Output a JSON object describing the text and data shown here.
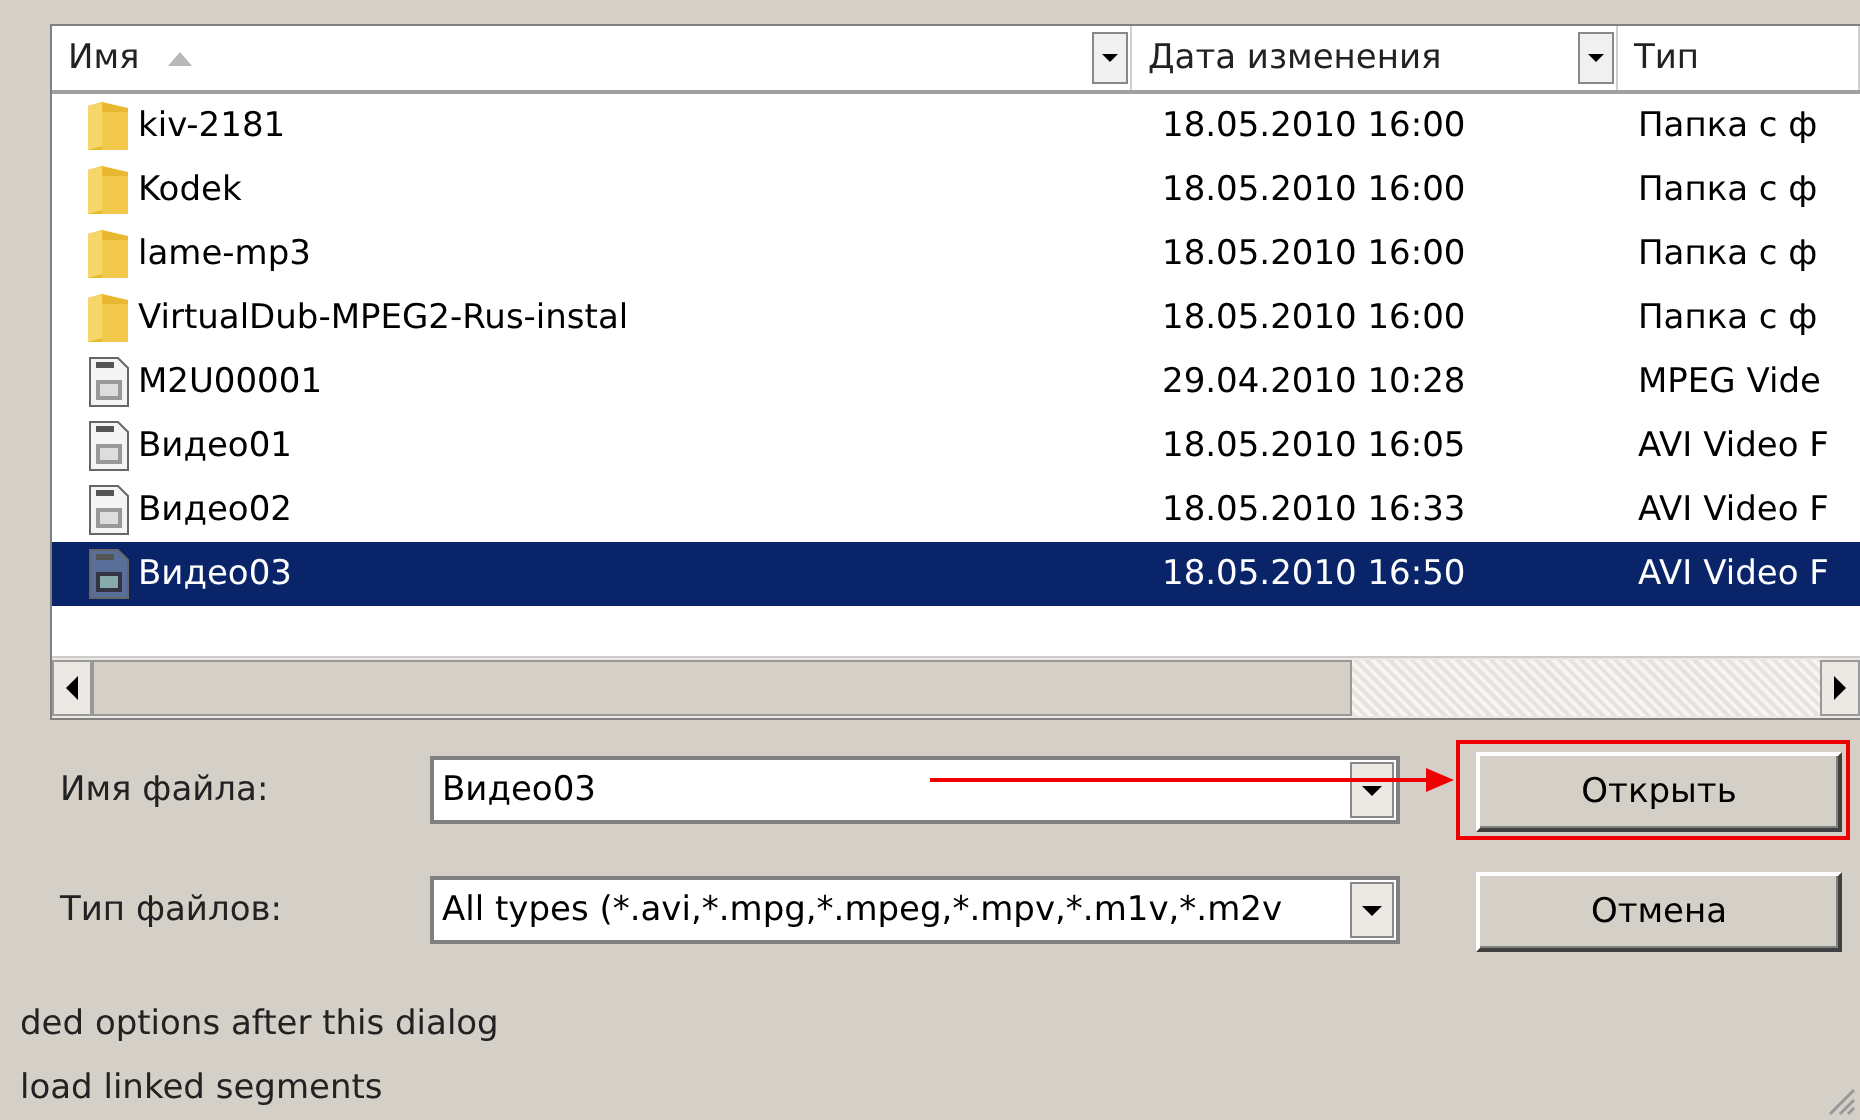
{
  "file_list": {
    "columns": [
      {
        "label": "Имя",
        "sorted": true,
        "dropdown": true
      },
      {
        "label": "Дата изменения",
        "sorted": false,
        "dropdown": true
      },
      {
        "label": "Тип",
        "sorted": false,
        "dropdown": false
      }
    ],
    "rows": [
      {
        "kind": "folder",
        "name": "kiv-2181",
        "date": "18.05.2010 16:00",
        "type": "Папка с ф",
        "selected": false
      },
      {
        "kind": "folder",
        "name": "Kodek",
        "date": "18.05.2010 16:00",
        "type": "Папка с ф",
        "selected": false
      },
      {
        "kind": "folder",
        "name": "lame-mp3",
        "date": "18.05.2010 16:00",
        "type": "Папка с ф",
        "selected": false
      },
      {
        "kind": "folder",
        "name": "VirtualDub-MPEG2-Rus-instal",
        "date": "18.05.2010 16:00",
        "type": "Папка с ф",
        "selected": false
      },
      {
        "kind": "video",
        "name": "M2U00001",
        "date": "29.04.2010 10:28",
        "type": "MPEG Vide",
        "selected": false
      },
      {
        "kind": "video",
        "name": "Видео01",
        "date": "18.05.2010 16:05",
        "type": "AVI Video F",
        "selected": false
      },
      {
        "kind": "video",
        "name": "Видео02",
        "date": "18.05.2010 16:33",
        "type": "AVI Video F",
        "selected": false
      },
      {
        "kind": "video",
        "name": "Видео03",
        "date": "18.05.2010 16:50",
        "type": "AVI Video F",
        "selected": true
      }
    ]
  },
  "file_name": {
    "label": "Имя файла:",
    "value": "Видео03"
  },
  "file_type": {
    "label": "Тип файлов:",
    "value": "All types (*.avi,*.mpg,*.mpeg,*.mpv,*.m1v,*.m2v"
  },
  "buttons": [
    {
      "label": "Открыть",
      "highlighted": true
    },
    {
      "label": "Отмена",
      "highlighted": false
    }
  ],
  "options": [
    "ded options after this dialog",
    "load linked segments"
  ]
}
